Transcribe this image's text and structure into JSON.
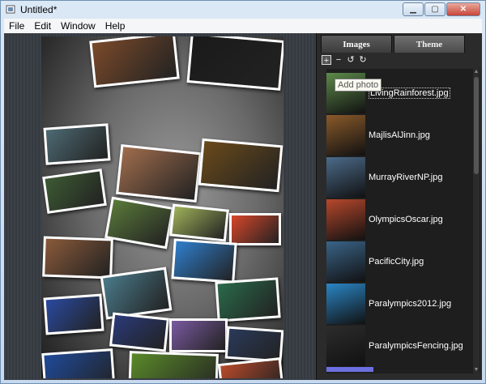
{
  "window": {
    "title": "Untitled*"
  },
  "menu": [
    "File",
    "Edit",
    "Window",
    "Help"
  ],
  "sidebar": {
    "tabs": [
      {
        "label": "Images"
      },
      {
        "label": "Theme"
      }
    ],
    "toolbar": {
      "tooltip": "Add photo",
      "icons": [
        "add-icon",
        "remove-icon",
        "rotate-left-icon",
        "rotate-right-icon"
      ]
    },
    "images": [
      {
        "label": "LivingRainforest.jpg",
        "selected": true,
        "color": "#5d8a4a"
      },
      {
        "label": "MajlisAlJinn.jpg",
        "color": "#8a5a2a"
      },
      {
        "label": "MurrayRiverNP.jpg",
        "color": "#4c6b8a"
      },
      {
        "label": "OlympicsOscar.jpg",
        "color": "#b8482c"
      },
      {
        "label": "PacificCity.jpg",
        "color": "#3a6488"
      },
      {
        "label": "Paralympics2012.jpg",
        "color": "#2a86c6"
      },
      {
        "label": "ParalympicsFencing.jpg",
        "color": "#2c2c2c"
      }
    ]
  },
  "collage": {
    "photos": [
      {
        "name": "photo-crowd",
        "color": "#7a4a2a"
      },
      {
        "name": "photo-horse-carriage",
        "color": "#1a1a1a"
      },
      {
        "name": "photo-rocky-coast",
        "color": "#4d6a73"
      },
      {
        "name": "photo-dancers",
        "color": "#a06d4d"
      },
      {
        "name": "photo-cave",
        "color": "#6a4a1a"
      },
      {
        "name": "photo-waterfall",
        "color": "#3d5a33"
      },
      {
        "name": "photo-birds",
        "color": "#5a7a3a"
      },
      {
        "name": "photo-leaves",
        "color": "#9fb25a"
      },
      {
        "name": "photo-crayons",
        "color": "#d8462a"
      },
      {
        "name": "photo-sunset-coast",
        "color": "#8a5a3a"
      },
      {
        "name": "photo-swimmer",
        "color": "#2f7fcf"
      },
      {
        "name": "photo-shoreline",
        "color": "#4a7a8a"
      },
      {
        "name": "photo-river",
        "color": "#2a6a4a"
      },
      {
        "name": "photo-city-night",
        "color": "#2a4aa0"
      },
      {
        "name": "photo-beach-sunset",
        "color": "#2a3a7a"
      },
      {
        "name": "photo-purple-sky",
        "color": "#7a5aa0"
      },
      {
        "name": "photo-fencing",
        "color": "#2a3a5a"
      },
      {
        "name": "photo-bay",
        "color": "#1f4a9a"
      },
      {
        "name": "photo-sailboats",
        "color": "#5a8a2a"
      },
      {
        "name": "photo-track",
        "color": "#b84a2a"
      }
    ]
  }
}
